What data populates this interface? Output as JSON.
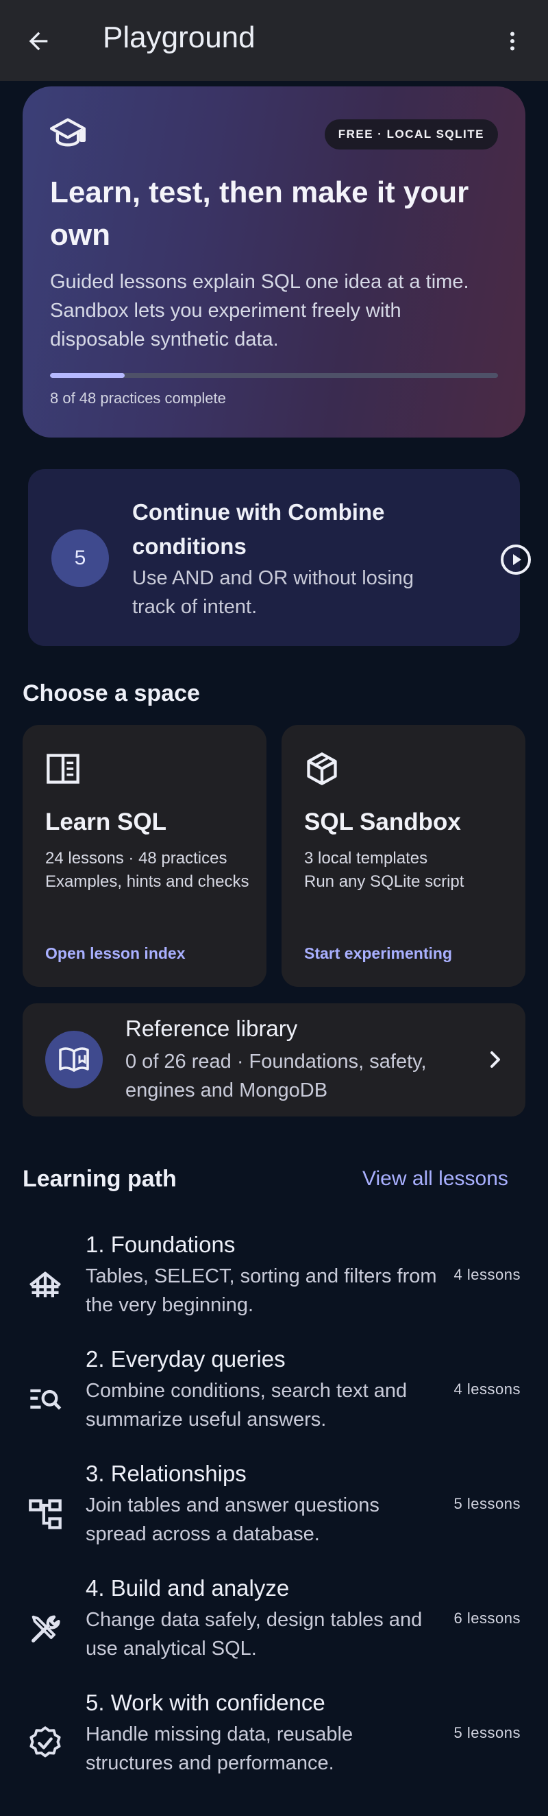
{
  "appbar": {
    "title": "Playground",
    "back_icon": "arrow-left-icon",
    "more_icon": "more-vert-icon"
  },
  "hero": {
    "badge": "FREE · LOCAL SQLITE",
    "headline": "Learn, test, then make it your own",
    "description": "Guided lessons explain SQL one idea at a time. Sandbox lets you experiment freely with disposable synthetic data.",
    "progress_fraction": 0.1667,
    "progress_text": "8 of 48 practices complete"
  },
  "continue": {
    "number": "5",
    "title": "Continue with Combine conditions",
    "subtitle": "Use AND and OR without losing track of intent."
  },
  "spaces": {
    "title": "Choose a space",
    "learn": {
      "title": "Learn SQL",
      "line1": "24 lessons · 48 practices",
      "line2": "Examples, hints and checks",
      "link": "Open lesson index"
    },
    "sandbox": {
      "title": "SQL Sandbox",
      "line1": "3 local templates",
      "line2": "Run any SQLite script",
      "link": "Start experimenting"
    }
  },
  "reference": {
    "title": "Reference library",
    "subtitle": "0 of 26 read · Foundations, safety, engines and MongoDB"
  },
  "path": {
    "title": "Learning path",
    "view_all": "View all lessons",
    "items": [
      {
        "title": "1. Foundations",
        "subtitle": "Tables, SELECT, sorting and filters from the very beginning.",
        "count": "4 lessons",
        "icon": "foundation-icon"
      },
      {
        "title": "2. Everyday queries",
        "subtitle": "Combine conditions, search text and summarize useful answers.",
        "count": "4 lessons",
        "icon": "manage-search-icon"
      },
      {
        "title": "3. Relationships",
        "subtitle": "Join tables and answer questions spread across a database.",
        "count": "5 lessons",
        "icon": "account-tree-icon"
      },
      {
        "title": "4. Build and analyze",
        "subtitle": "Change data safely, design tables and use analytical SQL.",
        "count": "6 lessons",
        "icon": "tools-icon"
      },
      {
        "title": "5. Work with confidence",
        "subtitle": "Handle missing data, reusable structures and performance.",
        "count": "5 lessons",
        "icon": "verified-icon"
      }
    ]
  },
  "colors": {
    "background": "#0a1220",
    "accent": "#a9b0ff",
    "card": "#202024",
    "continue_card": "#1d2144"
  }
}
